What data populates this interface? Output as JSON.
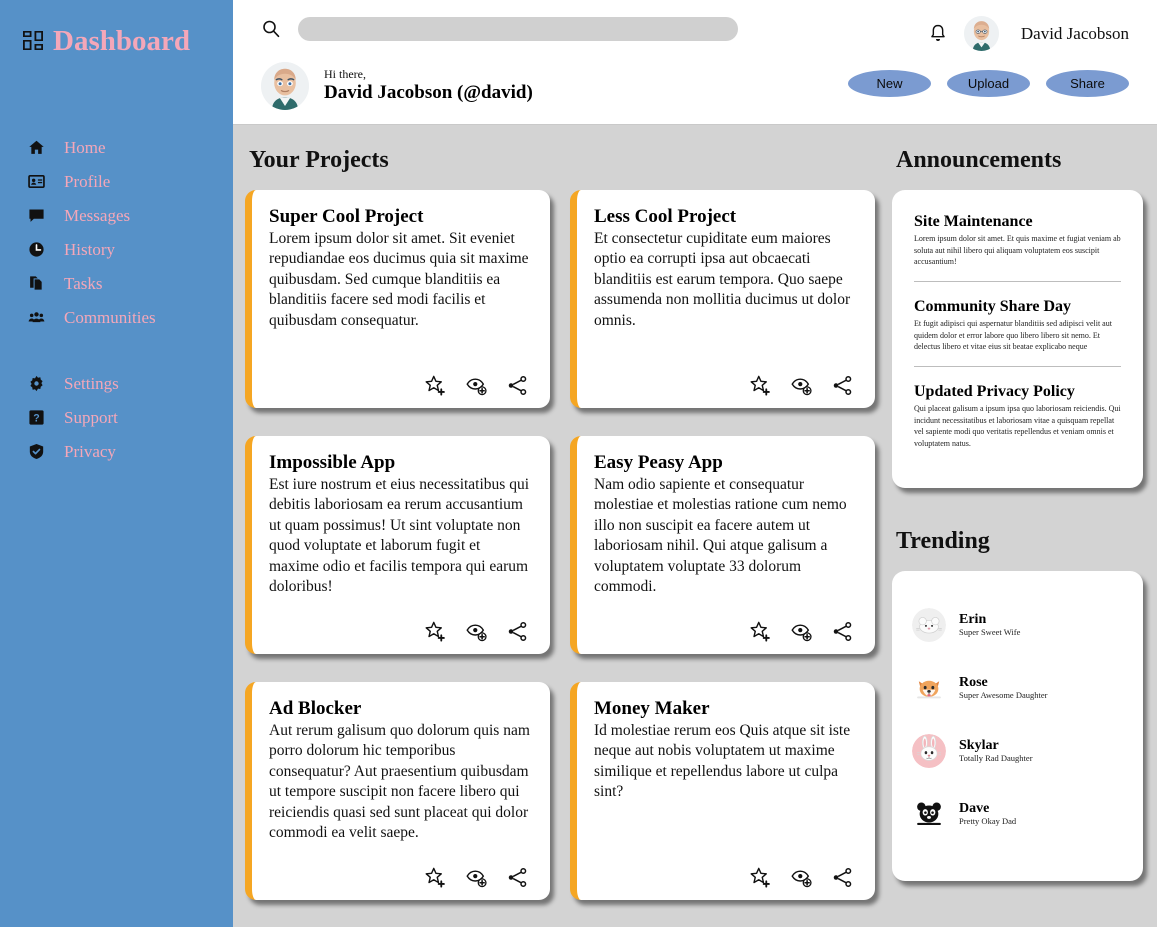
{
  "brand": {
    "title": "Dashboard",
    "logo_icon": "grid-dashboard-icon",
    "text_color": "#f4a7b9",
    "sidebar_color": "#5691c8"
  },
  "sidebar": {
    "primary_items": [
      {
        "label": "Home",
        "icon": "home-icon"
      },
      {
        "label": "Profile",
        "icon": "id-card-icon"
      },
      {
        "label": "Messages",
        "icon": "chat-bubble-icon"
      },
      {
        "label": "History",
        "icon": "clock-icon"
      },
      {
        "label": "Tasks",
        "icon": "documents-icon"
      },
      {
        "label": "Communities",
        "icon": "people-group-icon"
      }
    ],
    "secondary_items": [
      {
        "label": "Settings",
        "icon": "gear-icon"
      },
      {
        "label": "Support",
        "icon": "question-box-icon"
      },
      {
        "label": "Privacy",
        "icon": "shield-check-icon"
      }
    ]
  },
  "header": {
    "search": {
      "value": "",
      "placeholder": "",
      "icon": "search-icon"
    },
    "bell_icon": "bell-icon",
    "account_name": "David Jacobson",
    "avatar_icon": "avatar",
    "greeting_pretext": "Hi there,",
    "greeting_name": "David Jacobson (@david)",
    "buttons": [
      {
        "label": "New",
        "name": "new-button"
      },
      {
        "label": "Upload",
        "name": "upload-button"
      },
      {
        "label": "Share",
        "name": "share-button"
      }
    ],
    "button_color": "#7b9bd1"
  },
  "projects": {
    "heading": "Your Projects",
    "accent_color": "#f5a623",
    "card_actions": [
      {
        "icon": "star-plus-icon",
        "name": "favorite-add-button"
      },
      {
        "icon": "eye-plus-icon",
        "name": "watch-add-button"
      },
      {
        "icon": "share-nodes-icon",
        "name": "share-button"
      }
    ],
    "items": [
      {
        "title": "Super Cool Project",
        "body": "Lorem ipsum dolor sit amet. Sit eveniet repudiandae eos ducimus quia sit maxime quibusdam. Sed cumque blanditiis ea blanditiis facere sed modi facilis et quibusdam consequatur."
      },
      {
        "title": "Less Cool Project",
        "body": "Et consectetur cupiditate eum maiores optio ea corrupti ipsa aut obcaecati blanditiis est earum tempora. Quo saepe assumenda non mollitia ducimus ut dolor omnis."
      },
      {
        "title": "Impossible App",
        "body": "Est iure nostrum et eius necessitatibus qui debitis laboriosam ea rerum accusantium ut quam possimus! Ut sint voluptate non quod voluptate et laborum fugit et maxime odio et facilis tempora qui earum doloribus!"
      },
      {
        "title": "Easy Peasy App",
        "body": "Nam odio sapiente et consequatur molestiae et molestias ratione cum nemo illo non suscipit ea facere autem ut laboriosam nihil. Qui atque galisum a voluptatem voluptate 33 dolorum commodi."
      },
      {
        "title": "Ad Blocker",
        "body": "Aut rerum galisum quo dolorum quis nam porro dolorum hic temporibus consequatur? Aut praesentium quibusdam ut tempore suscipit non facere libero qui reiciendis quasi sed sunt placeat qui dolor commodi ea velit saepe."
      },
      {
        "title": "Money Maker",
        "body": "Id molestiae rerum eos Quis atque sit iste neque aut nobis voluptatem ut maxime similique et repellendus labore ut culpa sint?"
      }
    ]
  },
  "announcements": {
    "heading": "Announcements",
    "items": [
      {
        "title": "Site Maintenance",
        "body": "Lorem ipsum dolor sit amet. Et quis maxime et fugiat veniam ab soluta aut nihil libero qui aliquam voluptatem eos suscipit accusantium!"
      },
      {
        "title": "Community Share Day",
        "body": "Et fugit adipisci qui aspernatur blanditiis sed adipisci velit aut quidem dolor et error labore quo libero libero sit nemo. Et delectus libero et vitae eius sit beatae explicabo neque"
      },
      {
        "title": "Updated Privacy Policy",
        "body": "Qui placeat galisum a ipsum ipsa quo laboriosam reiciendis. Qui incidunt necessitatibus et laboriosam vitae a quisquam repellat vel sapiente modi quo veritatis repellendus et veniam omnis et voluptatem natus."
      }
    ]
  },
  "trending": {
    "heading": "Trending",
    "items": [
      {
        "name": "Erin",
        "role": "Super Sweet Wife",
        "avatar_icon": "mouse-avatar-icon",
        "avatar_bg": "#efefef"
      },
      {
        "name": "Rose",
        "role": "Super Awesome Daughter",
        "avatar_icon": "dog-avatar-icon",
        "avatar_bg": "#ffffff"
      },
      {
        "name": "Skylar",
        "role": "Totally Rad Daughter",
        "avatar_icon": "rabbit-avatar-icon",
        "avatar_bg": "#f5c0c4"
      },
      {
        "name": "Dave",
        "role": "Pretty Okay Dad",
        "avatar_icon": "panda-avatar-icon",
        "avatar_bg": "#ffffff"
      }
    ]
  }
}
